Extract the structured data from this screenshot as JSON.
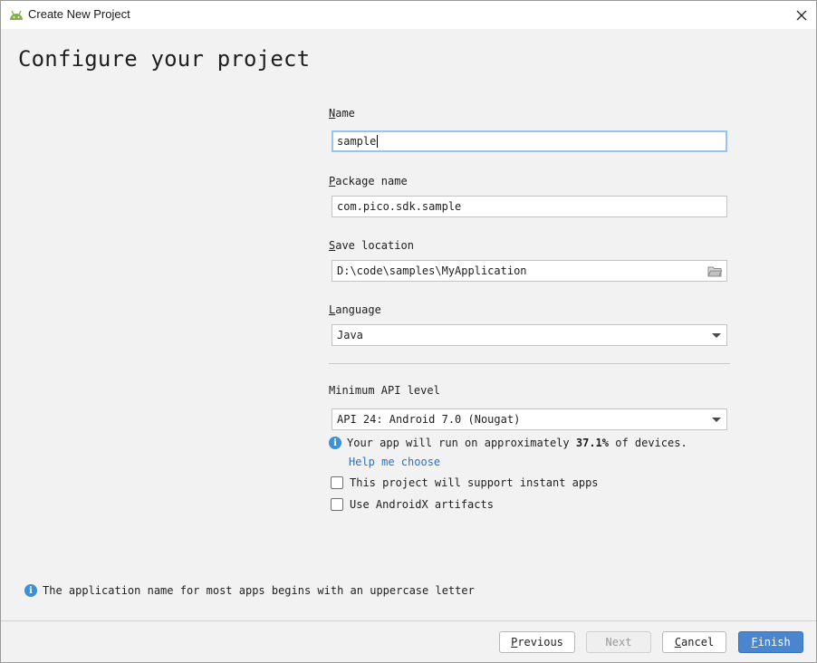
{
  "window": {
    "title": "Create New Project"
  },
  "page_title": "Configure your project",
  "fields": {
    "name": {
      "label_mnemonic": "N",
      "label_rest": "ame",
      "value": "sample"
    },
    "package": {
      "label_mnemonic": "P",
      "label_rest": "ackage name",
      "value": "com.pico.sdk.sample"
    },
    "save_location": {
      "label_mnemonic": "S",
      "label_rest": "ave location",
      "value": "D:\\code\\samples\\MyApplication"
    },
    "language": {
      "label_mnemonic": "L",
      "label_rest": "anguage",
      "selected": "Java"
    },
    "min_api": {
      "label": "Minimum API level",
      "selected": "API 24: Android 7.0 (Nougat)"
    }
  },
  "api_info": {
    "prefix": "Your app will run on approximately ",
    "percent": "37.1%",
    "suffix": " of devices.",
    "help_link": "Help me choose"
  },
  "checkboxes": [
    {
      "label": "This project will support instant apps",
      "checked": false
    },
    {
      "label": "Use AndroidX artifacts",
      "checked": false
    }
  ],
  "bottom_hint": "The application name for most apps begins with an uppercase letter",
  "buttons": {
    "previous": {
      "mnemonic": "P",
      "rest": "revious"
    },
    "next": {
      "label": "Next"
    },
    "cancel": {
      "mnemonic": "C",
      "rest": "ancel"
    },
    "finish": {
      "mnemonic": "F",
      "rest": "inish"
    }
  },
  "colors": {
    "accent": "#4a86d0",
    "link": "#2f6fbf",
    "info": "#3d8fd6",
    "focus_border": "#97c3f3",
    "android_green": "#7cb342"
  },
  "icons": {
    "app": "android-icon",
    "close": "close-icon",
    "folder": "folder-icon",
    "info": "info-icon",
    "dropdown": "chevron-down-icon"
  }
}
